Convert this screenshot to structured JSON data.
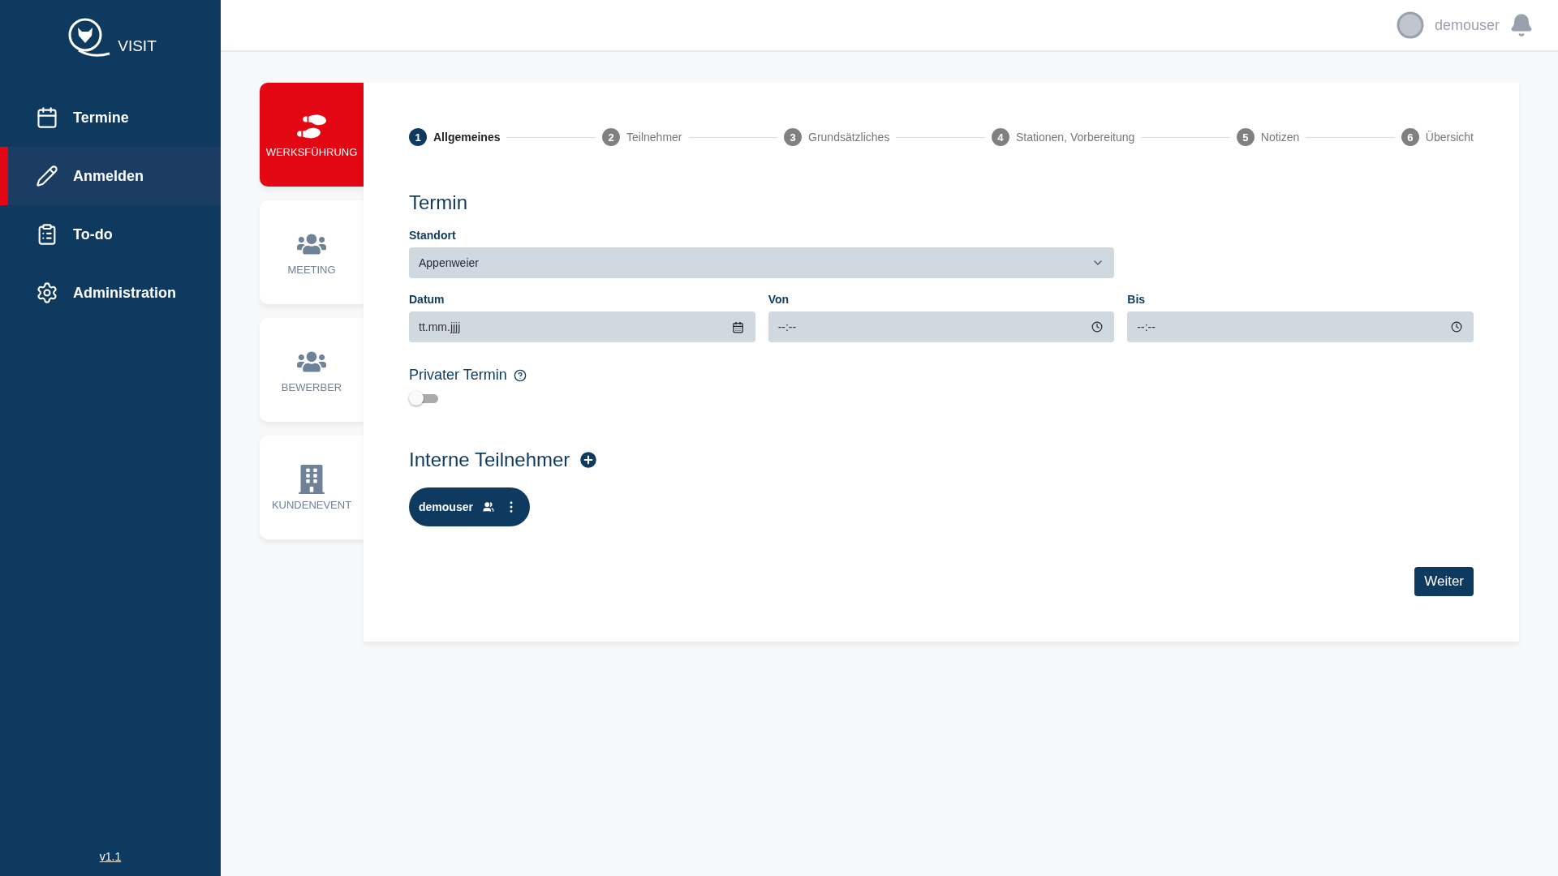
{
  "sidebar": {
    "logo_text": "VISIT",
    "items": [
      {
        "label": "Termine",
        "selected": false
      },
      {
        "label": "Anmelden",
        "selected": true
      },
      {
        "label": "To-do",
        "selected": false
      },
      {
        "label": "Administration",
        "selected": false
      }
    ],
    "version": "v1.1"
  },
  "header": {
    "user": "demouser"
  },
  "categories": [
    {
      "label": "WERKSFÜHRUNG",
      "selected": true
    },
    {
      "label": "MEETING",
      "selected": false
    },
    {
      "label": "BEWERBER",
      "selected": false
    },
    {
      "label": "KUNDENEVENT",
      "selected": false
    }
  ],
  "steps": [
    {
      "number": "1",
      "label": "Allgemeines",
      "selected": true
    },
    {
      "number": "2",
      "label": "Teilnehmer",
      "selected": false
    },
    {
      "number": "3",
      "label": "Grundsätzliches",
      "selected": false
    },
    {
      "number": "4",
      "label": "Stationen, Vorbereitung",
      "selected": false
    },
    {
      "number": "5",
      "label": "Notizen",
      "selected": false
    },
    {
      "number": "6",
      "label": "Übersicht",
      "selected": false
    }
  ],
  "form": {
    "title": "Termin",
    "location": {
      "label": "Standort",
      "value": "Appenweier"
    },
    "fields": [
      {
        "label": "Datum",
        "placeholder": "tt.mm.jjjj",
        "kind": "date"
      },
      {
        "label": "Von",
        "placeholder": "--:--",
        "kind": "time"
      },
      {
        "label": "Bis",
        "placeholder": "--:--",
        "kind": "time"
      }
    ],
    "private": {
      "label": "Privater Termin",
      "on": false
    }
  },
  "participants": {
    "title": "Interne Teilnehmer",
    "chips": [
      {
        "name": "demouser"
      }
    ]
  },
  "next_button": "Weiter"
}
